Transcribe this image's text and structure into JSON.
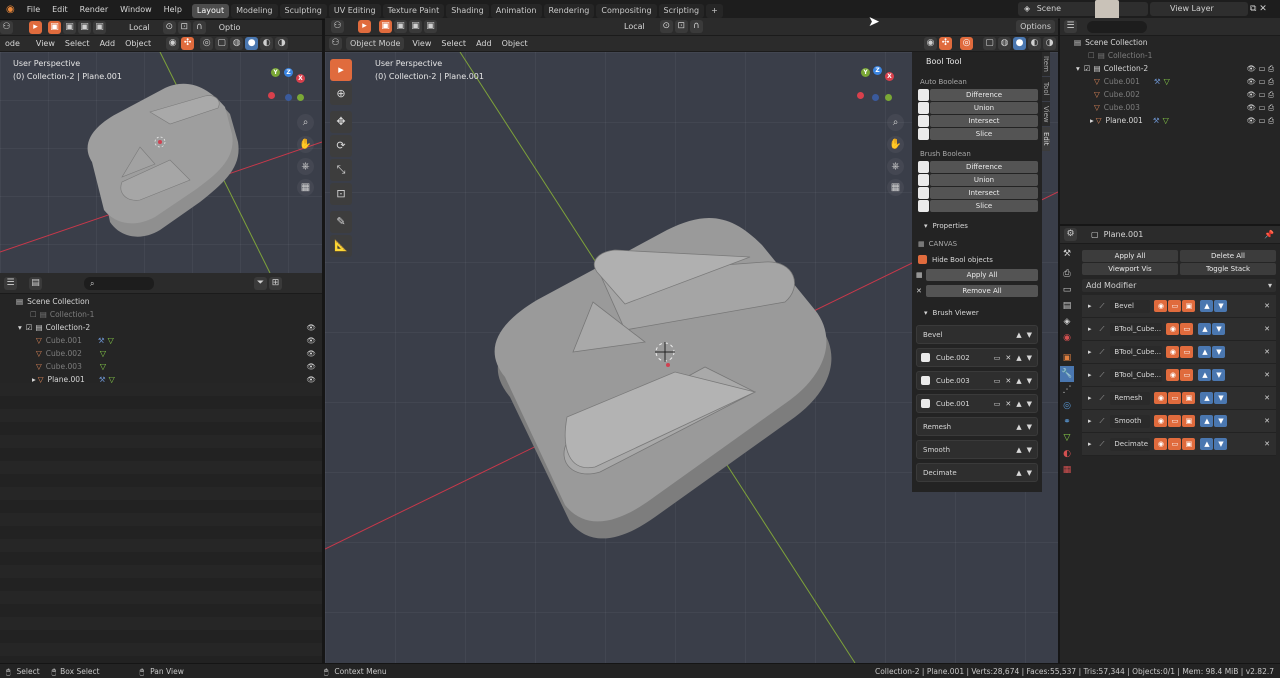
{
  "topbar": {
    "menus": [
      "File",
      "Edit",
      "Render",
      "Window",
      "Help"
    ],
    "workspaces": [
      "Layout",
      "Modeling",
      "Sculpting",
      "UV Editing",
      "Texture Paint",
      "Shading",
      "Animation",
      "Rendering",
      "Compositing",
      "Scripting"
    ],
    "add_tab": "+",
    "scene": "Scene",
    "view_layer": "View Layer"
  },
  "left_viewport": {
    "mode": "ode",
    "menus": [
      "View",
      "Select",
      "Add",
      "Object"
    ],
    "pivot": "Local",
    "options": "Optio",
    "title": "User Perspective",
    "subtitle": "(0) Collection-2 | Plane.001"
  },
  "main_viewport": {
    "mode": "Object Mode",
    "menus": [
      "View",
      "Select",
      "Add",
      "Object"
    ],
    "pivot": "Local",
    "options": "Options",
    "title": "User Perspective",
    "subtitle": "(0) Collection-2 | Plane.001"
  },
  "gizmo": {
    "x": "X",
    "y": "Y",
    "z": "Z"
  },
  "npanel": {
    "title": "Bool Tool",
    "tabs": [
      "Item",
      "Tool",
      "View",
      "Edit"
    ],
    "auto_boolean_label": "Auto Boolean",
    "auto_buttons": [
      "Difference",
      "Union",
      "Intersect",
      "Slice"
    ],
    "brush_boolean_label": "Brush Boolean",
    "brush_buttons": [
      "Difference",
      "Union",
      "Intersect",
      "Slice"
    ],
    "properties_label": "Properties",
    "canvas_label": "CANVAS",
    "hide_bool_label": "Hide Bool objects",
    "apply_all": "Apply All",
    "remove_all": "Remove All",
    "brush_viewer_label": "Brush Viewer",
    "modifiers": [
      {
        "name": "Bevel",
        "type": "plain"
      },
      {
        "name": "Cube.002",
        "type": "brush"
      },
      {
        "name": "Cube.003",
        "type": "brush"
      },
      {
        "name": "Cube.001",
        "type": "brush"
      },
      {
        "name": "Remesh",
        "type": "plain"
      },
      {
        "name": "Smooth",
        "type": "plain"
      },
      {
        "name": "Decimate",
        "type": "plain"
      }
    ]
  },
  "outliner_top": {
    "root": "Scene Collection",
    "items": [
      {
        "name": "Collection-1",
        "kind": "collection",
        "dim": true
      },
      {
        "name": "Collection-2",
        "kind": "collection",
        "dim": false
      },
      {
        "name": "Cube.001",
        "kind": "mesh",
        "dim": true
      },
      {
        "name": "Cube.002",
        "kind": "mesh",
        "dim": true
      },
      {
        "name": "Cube.003",
        "kind": "mesh",
        "dim": true
      },
      {
        "name": "Plane.001",
        "kind": "mesh",
        "dim": false
      }
    ]
  },
  "outliner_left": {
    "root": "Scene Collection",
    "items": [
      {
        "name": "Collection-1",
        "kind": "collection",
        "dim": true
      },
      {
        "name": "Collection-2",
        "kind": "collection",
        "dim": false
      },
      {
        "name": "Cube.001",
        "kind": "mesh",
        "dim": true
      },
      {
        "name": "Cube.002",
        "kind": "mesh",
        "dim": true
      },
      {
        "name": "Cube.003",
        "kind": "mesh",
        "dim": true
      },
      {
        "name": "Plane.001",
        "kind": "mesh",
        "dim": false
      }
    ]
  },
  "properties": {
    "object_name": "Plane.001",
    "apply_all": "Apply All",
    "delete_all": "Delete All",
    "viewport_vis": "Viewport Vis",
    "toggle_stack": "Toggle Stack",
    "add_modifier": "Add Modifier",
    "modifiers": [
      "Bevel",
      "BTool_Cube...",
      "BTool_Cube...",
      "BTool_Cube...",
      "Remesh",
      "Smooth",
      "Decimate"
    ]
  },
  "status": {
    "select": "Select",
    "box_select": "Box Select",
    "pan_view": "Pan View",
    "context_menu": "Context Menu",
    "stats": "Collection-2 | Plane.001 | Verts:28,674 | Faces:55,537 | Tris:57,344 | Objects:0/1 | Mem: 98.4 MiB | v2.82.7"
  },
  "colors": {
    "accent": "#e06b3d",
    "viewport_bg": "#3a3e49",
    "x_axis": "#c8384a",
    "y_axis": "#7ea23a",
    "gizmo_x": "#e8414c",
    "gizmo_y": "#8ac43a",
    "gizmo_z": "#3a84e0"
  }
}
